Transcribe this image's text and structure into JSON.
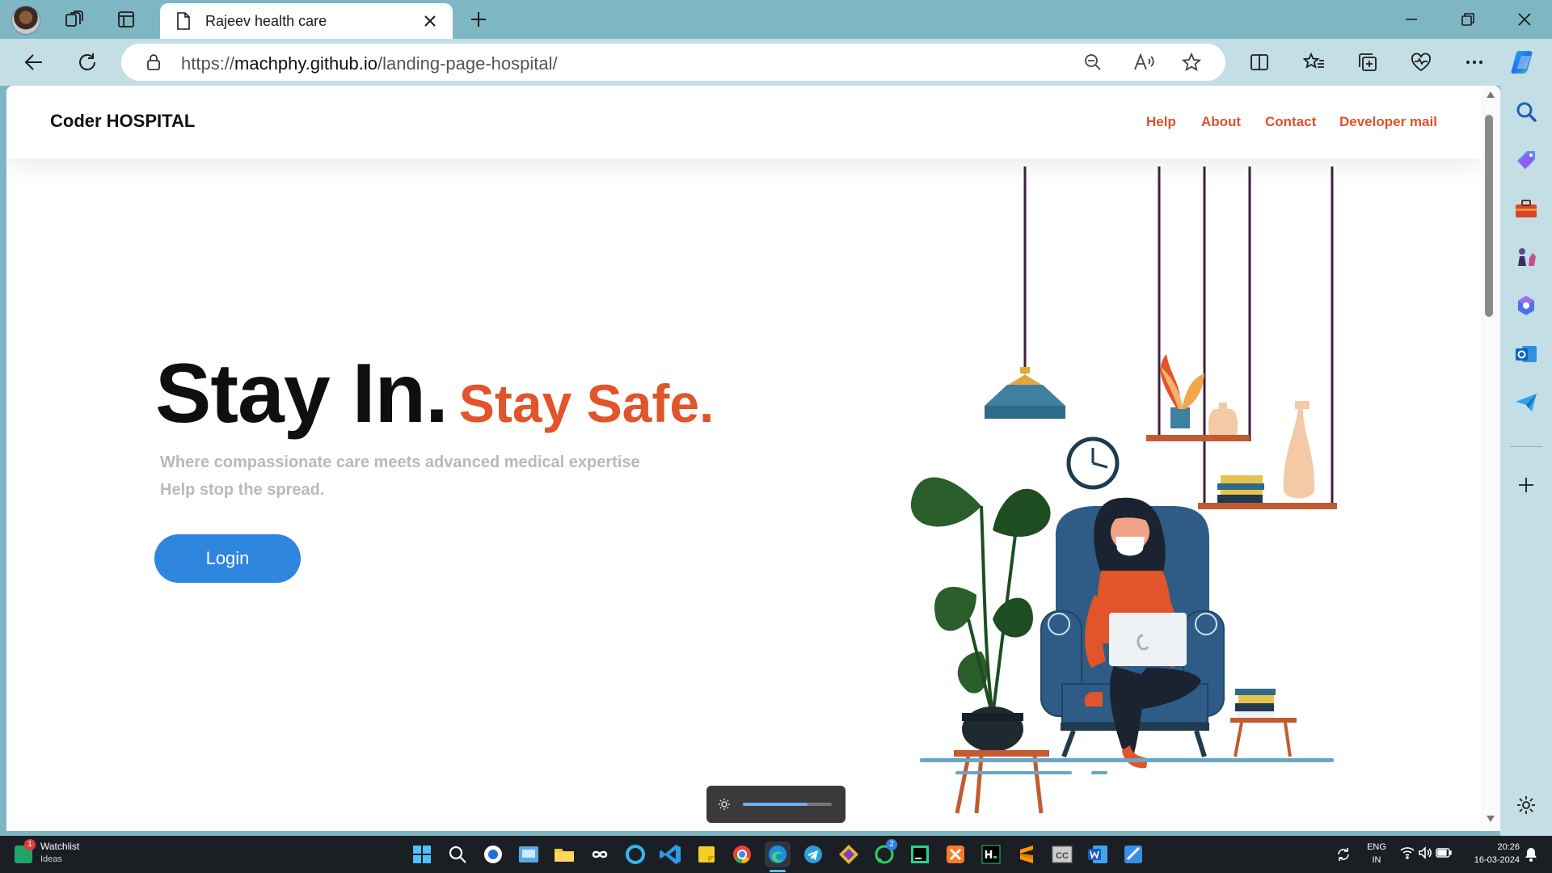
{
  "browser": {
    "tab_title": "Rajeev health care",
    "url_prefix": "https://",
    "url_host": "machphy.github.io",
    "url_path": "/landing-page-hospital/"
  },
  "site": {
    "brand": "Coder HOSPITAL",
    "nav": [
      "Help",
      "About",
      "Contact",
      "Developer mail"
    ],
    "hero_title_1": "Stay In.",
    "hero_title_2": "Stay Safe.",
    "subtitle_1": "Where compassionate care meets advanced medical expertise",
    "subtitle_2": "Help stop the spread.",
    "login_label": "Login",
    "accent_color": "#e2542a",
    "button_color": "#2e86de"
  },
  "taskbar": {
    "watchlist_title": "Watchlist",
    "watchlist_sub": "Ideas",
    "watchlist_badge": "1",
    "whatsapp_badge": "2",
    "lang_1": "ENG",
    "lang_2": "IN",
    "time": "20:26",
    "date": "16-03-2024"
  }
}
